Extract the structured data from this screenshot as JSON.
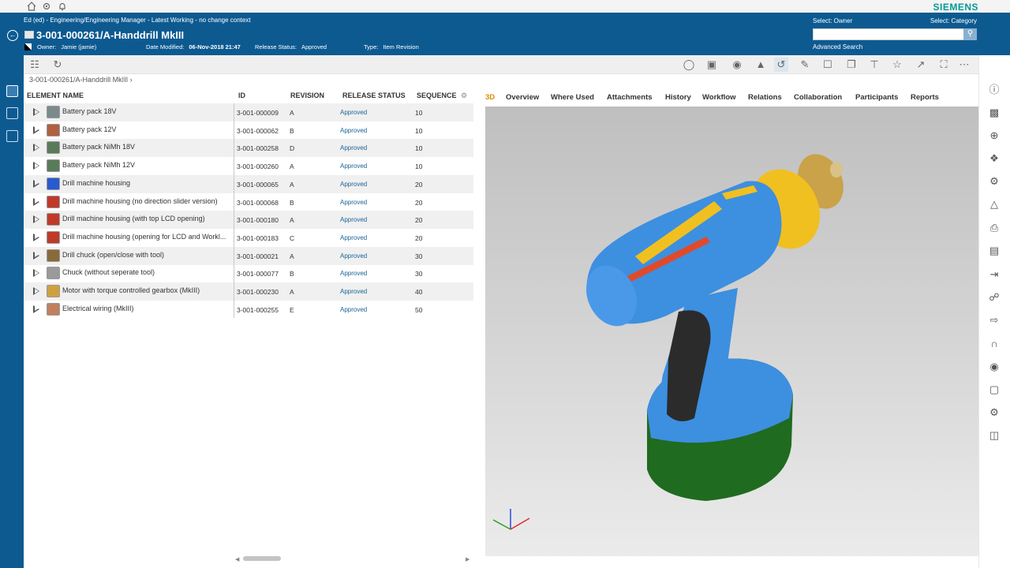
{
  "brand": "SIEMENS",
  "header": {
    "context": "Ed (ed) - Engineering/Engineering Manager - Latest Working - no change context",
    "title": "3-001-000261/A-Handdrill MkIII",
    "owner_label": "Owner:",
    "owner_value": "Jamie (jamie)",
    "date_label": "Date Modified:",
    "date_value": "06-Nov-2018 21:47",
    "status_label": "Release Status:",
    "status_value": "Approved",
    "type_label": "Type:",
    "type_value": "Item Revision",
    "select_owner": "Select: Owner",
    "select_category": "Select: Category",
    "search_placeholder": "",
    "advanced_search": "Advanced Search"
  },
  "breadcrumb": "3-001-000261/A-Handdrill MkIII",
  "tree": {
    "columns": [
      "ELEMENT NAME",
      "ID",
      "REVISION",
      "RELEASE STATUS",
      "SEQUENCE"
    ],
    "rows": [
      {
        "name": "Battery pack 18V",
        "id": "3-001-000009",
        "rev": "A",
        "status": "Approved",
        "seq": "10"
      },
      {
        "name": "Battery pack 12V",
        "id": "3-001-000062",
        "rev": "B",
        "status": "Approved",
        "seq": "10"
      },
      {
        "name": "Battery pack NiMh 18V",
        "id": "3-001-000258",
        "rev": "D",
        "status": "Approved",
        "seq": "10"
      },
      {
        "name": "Battery pack NiMh 12V",
        "id": "3-001-000260",
        "rev": "A",
        "status": "Approved",
        "seq": "10"
      },
      {
        "name": "Drill machine housing",
        "id": "3-001-000065",
        "rev": "A",
        "status": "Approved",
        "seq": "20"
      },
      {
        "name": "Drill machine housing (no direction slider version)",
        "id": "3-001-000068",
        "rev": "B",
        "status": "Approved",
        "seq": "20"
      },
      {
        "name": "Drill machine housing (with top LCD opening)",
        "id": "3-001-000180",
        "rev": "A",
        "status": "Approved",
        "seq": "20"
      },
      {
        "name": "Drill machine housing (opening for LCD and Workl...",
        "id": "3-001-000183",
        "rev": "C",
        "status": "Approved",
        "seq": "20"
      },
      {
        "name": "Drill chuck (open/close with tool)",
        "id": "3-001-000021",
        "rev": "A",
        "status": "Approved",
        "seq": "30"
      },
      {
        "name": "Chuck (without seperate tool)",
        "id": "3-001-000077",
        "rev": "B",
        "status": "Approved",
        "seq": "30"
      },
      {
        "name": "Motor with torque controlled gearbox (MkIII)",
        "id": "3-001-000230",
        "rev": "A",
        "status": "Approved",
        "seq": "40"
      },
      {
        "name": "Electrical wiring (MkIII)",
        "id": "3-001-000255",
        "rev": "E",
        "status": "Approved",
        "seq": "50"
      }
    ]
  },
  "tabs": [
    "3D",
    "Overview",
    "Where Used",
    "Attachments",
    "History",
    "Workflow",
    "Relations",
    "Collaboration",
    "Participants",
    "Reports"
  ],
  "active_tab": "3D",
  "colors": {
    "header_bg": "#0d5a91",
    "accent": "#e08a00",
    "brand": "#009999",
    "link": "#1a6496"
  }
}
